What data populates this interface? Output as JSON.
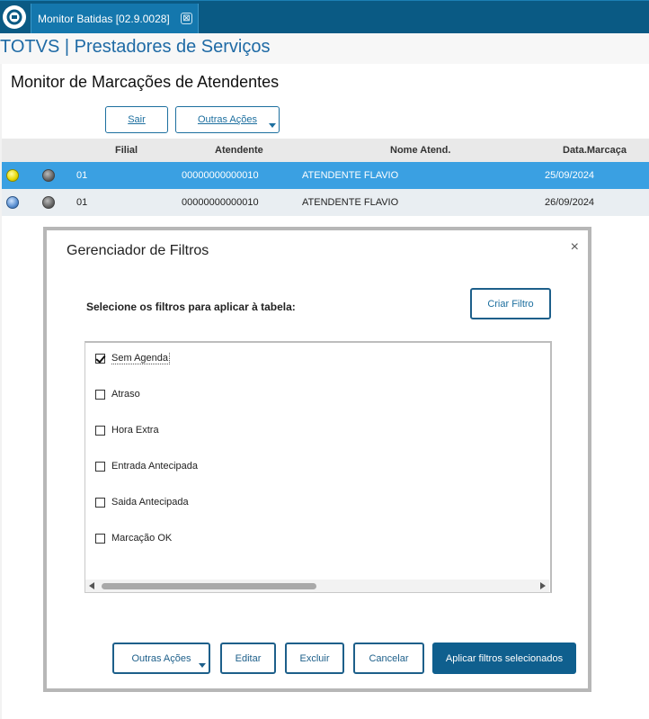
{
  "tab": {
    "label": "Monitor Batidas [02.9.0028]",
    "close_glyph": "⊠"
  },
  "app": {
    "title": "TOTVS | Prestadores de Serviços"
  },
  "page": {
    "title": "Monitor de Marcações de Atendentes",
    "buttons": {
      "sair": "Sair",
      "outras_acoes": "Outras Ações"
    }
  },
  "grid": {
    "columns": [
      "",
      "",
      "Filial",
      "Atendente",
      "Nome Atend.",
      "Data.Marcaça"
    ],
    "rows": [
      {
        "status1": "yellow",
        "status2": "gray",
        "filial": "01",
        "atendente": "00000000000010",
        "nome": "ATENDENTE FLAVIO",
        "data": "25/09/2024",
        "selected": true
      },
      {
        "status1": "blue",
        "status2": "gray",
        "filial": "01",
        "atendente": "00000000000010",
        "nome": "ATENDENTE FLAVIO",
        "data": "26/09/2024",
        "selected": false
      }
    ]
  },
  "modal": {
    "title": "Gerenciador de Filtros",
    "close_glyph": "×",
    "prompt": "Selecione os filtros para aplicar à tabela:",
    "criar_filtro": "Criar Filtro",
    "filters": [
      {
        "label": "Sem Agenda",
        "checked": true
      },
      {
        "label": "Atraso",
        "checked": false
      },
      {
        "label": "Hora Extra",
        "checked": false
      },
      {
        "label": "Entrada Antecipada",
        "checked": false
      },
      {
        "label": "Saida Antecipada",
        "checked": false
      },
      {
        "label": "Marcação OK",
        "checked": false
      }
    ],
    "footer": {
      "outras_acoes": "Outras Ações",
      "editar": "Editar",
      "excluir": "Excluir",
      "cancelar": "Cancelar",
      "aplicar": "Aplicar filtros selecionados"
    }
  },
  "colors": {
    "topbar": "#0a5a84",
    "tab": "#1477ad",
    "accent": "#1d6f9f",
    "selected_row": "#3aa0e2",
    "primary_button": "#0f5f8e"
  }
}
